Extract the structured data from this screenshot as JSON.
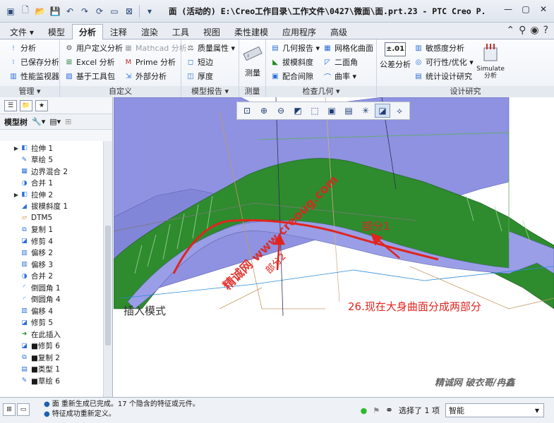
{
  "title": "面 (活动的) E:\\Creo工作目录\\工作文件\\0427\\微面\\面.prt.23 - PTC Creo P...",
  "tabs": [
    "文件 ▾",
    "模型",
    "分析",
    "注释",
    "渲染",
    "工具",
    "视图",
    "柔性建模",
    "应用程序",
    "高级"
  ],
  "active_tab": "分析",
  "ribbon": {
    "manage": {
      "items": [
        "分析",
        "已保存分析",
        "性能监视器"
      ],
      "footer": "管理 ▾"
    },
    "custom": {
      "items": [
        "用户定义分析",
        "Excel 分析",
        "基于工具包",
        "Mathcad 分析",
        "Prime 分析",
        "外部分析"
      ],
      "footer": "自定义"
    },
    "model_report": {
      "items": [
        "质量属性 ▾",
        "短边",
        "厚度"
      ],
      "footer": "模型报告 ▾"
    },
    "measure": {
      "label": "测量",
      "footer": "测量"
    },
    "inspect": {
      "items": [
        "几何报告 ▾",
        "网格化曲面",
        "拔模斜度",
        "二面角",
        "配合间隙",
        "曲率 ▾"
      ],
      "footer": "检查几何 ▾"
    },
    "design": {
      "tolerance": "公差分析",
      "tol_icon": "±.01",
      "items": [
        "敏感度分析",
        "可行性/优化 ▾",
        "统计设计研究"
      ],
      "simulate": "Simulate 分析",
      "footer": "设计研究"
    }
  },
  "left_panel": {
    "header": "模型树",
    "tree": [
      {
        "label": "拉伸 1",
        "exp": "▶",
        "icon": "◧",
        "color": "#2a6fd6",
        "level": 0
      },
      {
        "label": "草绘 5",
        "exp": "",
        "icon": "✎",
        "color": "#2a6fd6",
        "level": 0
      },
      {
        "label": "边界混合 2",
        "exp": "",
        "icon": "▦",
        "color": "#2a6fd6",
        "level": 0
      },
      {
        "label": "合并 1",
        "exp": "",
        "icon": "◑",
        "color": "#2a6fd6",
        "level": 0
      },
      {
        "label": "拉伸 2",
        "exp": "▶",
        "icon": "◧",
        "color": "#2a6fd6",
        "level": 0
      },
      {
        "label": "拔模斜度 1",
        "exp": "",
        "icon": "◢",
        "color": "#2a6fd6",
        "level": 0
      },
      {
        "label": "DTM5",
        "exp": "",
        "icon": "▱",
        "color": "#c07a00",
        "level": 0
      },
      {
        "label": "复制 1",
        "exp": "",
        "icon": "⧉",
        "color": "#2a6fd6",
        "level": 0
      },
      {
        "label": "修剪 4",
        "exp": "",
        "icon": "◪",
        "color": "#2a6fd6",
        "level": 0
      },
      {
        "label": "偏移 2",
        "exp": "",
        "icon": "▥",
        "color": "#2a6fd6",
        "level": 0
      },
      {
        "label": "偏移 3",
        "exp": "",
        "icon": "▥",
        "color": "#2a6fd6",
        "level": 0
      },
      {
        "label": "合并 2",
        "exp": "",
        "icon": "◑",
        "color": "#2a6fd6",
        "level": 0
      },
      {
        "label": "倒圆角 1",
        "exp": "",
        "icon": "◜",
        "color": "#2a6fd6",
        "level": 0
      },
      {
        "label": "倒圆角 4",
        "exp": "",
        "icon": "◜",
        "color": "#2a6fd6",
        "level": 0
      },
      {
        "label": "偏移 4",
        "exp": "",
        "icon": "▥",
        "color": "#2a6fd6",
        "level": 0
      },
      {
        "label": "修剪 5",
        "exp": "",
        "icon": "◪",
        "color": "#2a6fd6",
        "level": 0
      },
      {
        "label": "在此插入",
        "exp": "",
        "icon": "➜",
        "color": "#1e8a1e",
        "level": 0
      },
      {
        "label": "■修剪 6",
        "exp": "",
        "icon": "◪",
        "color": "#2a6fd6",
        "level": 0
      },
      {
        "label": "■复制 2",
        "exp": "",
        "icon": "⧉",
        "color": "#2a6fd6",
        "level": 0
      },
      {
        "label": "■类型 1",
        "exp": "",
        "icon": "▤",
        "color": "#2a6fd6",
        "level": 0
      },
      {
        "label": "■草绘 6",
        "exp": "",
        "icon": "✎",
        "color": "#2a6fd6",
        "level": 0
      }
    ]
  },
  "viewport": {
    "mode_text": "插入模式",
    "annotation": "26.现在大身曲面分成两部分",
    "part1_label": "部分1",
    "part2_label": "部分2",
    "watermark": "精诚网 www.creoug.com",
    "signature": "精诚网 破衣哥/冉鑫"
  },
  "status": {
    "messages": [
      "面 重新生成已完成。17 个隐含的特征或元件。",
      "特征成功重新定义。"
    ],
    "selected": "选择了 1 项",
    "filter": "智能"
  },
  "colors": {
    "surface_blue": "#8e92e0",
    "surface_green": "#2e8b2e",
    "highlight": "#e0251f",
    "tree_blue": "#2a6fd6"
  }
}
